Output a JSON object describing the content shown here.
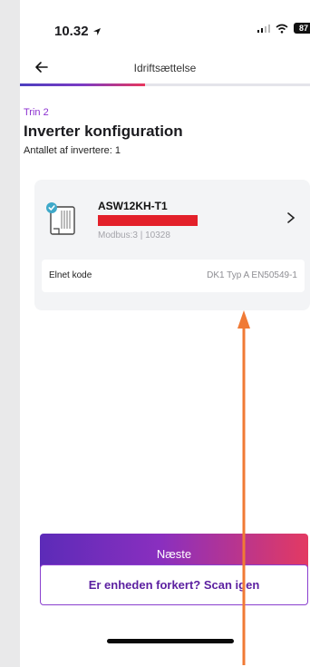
{
  "status_bar": {
    "time": "10.32",
    "battery": "87"
  },
  "nav": {
    "title": "Idriftsættelse",
    "progress": 0.43
  },
  "page": {
    "step": "Trin 2",
    "title": "Inverter konfiguration",
    "count_text": "Antallet af invertere: 1"
  },
  "device": {
    "name": "ASW12KH-T1",
    "meta": "Modbus:3 | 10328"
  },
  "grid_code": {
    "label": "Elnet kode",
    "value": "DK1 Typ A EN50549-1"
  },
  "buttons": {
    "next": "Næste",
    "rescan": "Er enheden forkert? Scan igen"
  },
  "colors": {
    "accent_purple": "#8b2fd0",
    "gradient_start": "#5c2bb8",
    "gradient_end": "#e33a62",
    "redaction": "#e3202a",
    "annotation_arrow": "#f07a35",
    "check_badge": "#3fa9c9"
  },
  "icons": [
    "location-arrow-icon",
    "signal-icon",
    "wifi-icon",
    "battery-icon",
    "back-arrow-icon",
    "inverter-icon",
    "check-badge-icon",
    "chevron-right-icon",
    "annotation-arrow"
  ]
}
